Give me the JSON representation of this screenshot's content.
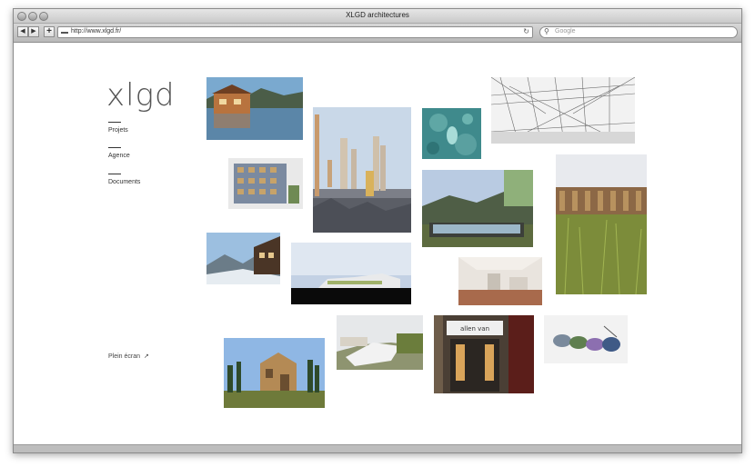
{
  "browser": {
    "title": "XLGD architectures",
    "url": "http://www.xlgd.fr/",
    "search_placeholder": "Google",
    "back_icon": "back-arrow-icon",
    "forward_icon": "forward-arrow-icon",
    "add_icon": "plus-icon",
    "reload_icon": "reload-icon"
  },
  "site": {
    "logo": "xlgd",
    "nav": [
      {
        "label": "Projets"
      },
      {
        "label": "Agence"
      },
      {
        "label": "Documents"
      }
    ],
    "fullscreen_label": "Plein écran"
  },
  "gallery": [
    {
      "subject": "chalet-by-lake"
    },
    {
      "subject": "apartment-building"
    },
    {
      "subject": "towers-over-city"
    },
    {
      "subject": "teal-artwork"
    },
    {
      "subject": "station-sketch"
    },
    {
      "subject": "house-in-hills"
    },
    {
      "subject": "wooden-building-meadow"
    },
    {
      "subject": "mountain-chalet"
    },
    {
      "subject": "building-elevation"
    },
    {
      "subject": "interior"
    },
    {
      "subject": "hillside-housing"
    },
    {
      "subject": "shop-front"
    },
    {
      "subject": "capsule-vehicle"
    },
    {
      "subject": "timber-house"
    }
  ],
  "shop_sign": "allen van"
}
